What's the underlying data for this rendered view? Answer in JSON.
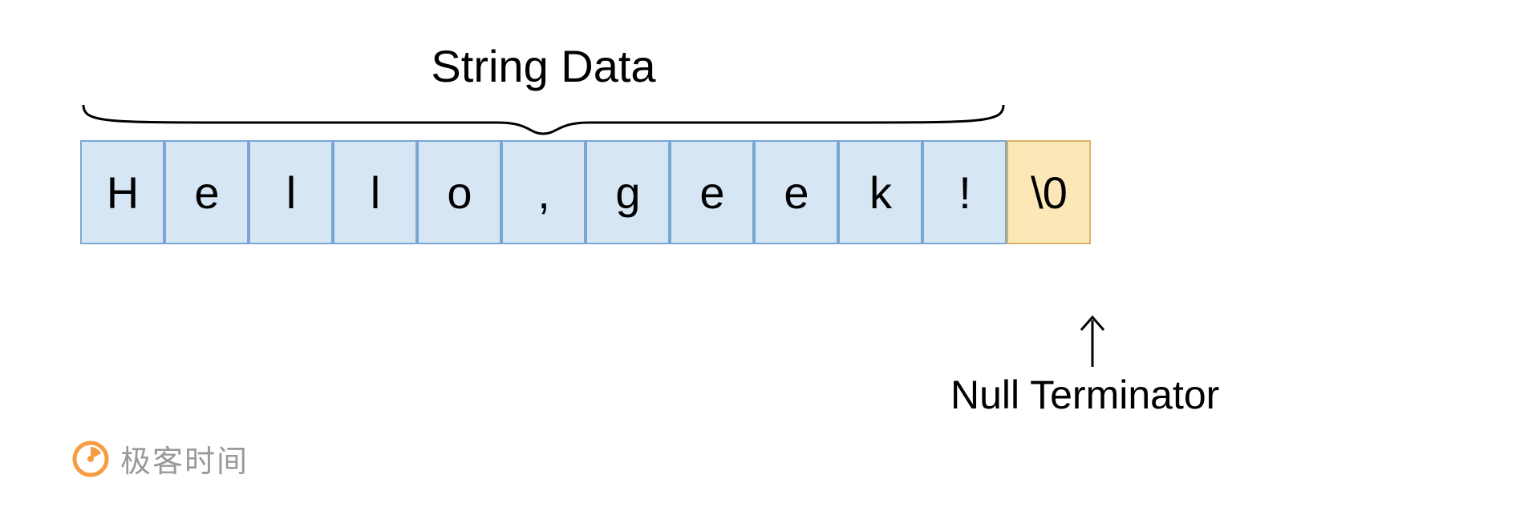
{
  "title": "String Data",
  "cells": [
    "H",
    "e",
    "l",
    "l",
    "o",
    ",",
    "g",
    "e",
    "e",
    "k",
    "!"
  ],
  "null_terminator": "\\0",
  "null_label": "Null Terminator",
  "watermark_text": "极客时间",
  "colors": {
    "data_fill": "#d6e6f5",
    "data_border": "#7aa6d6",
    "null_fill": "#fce7b6",
    "null_border": "#d9b26a"
  }
}
